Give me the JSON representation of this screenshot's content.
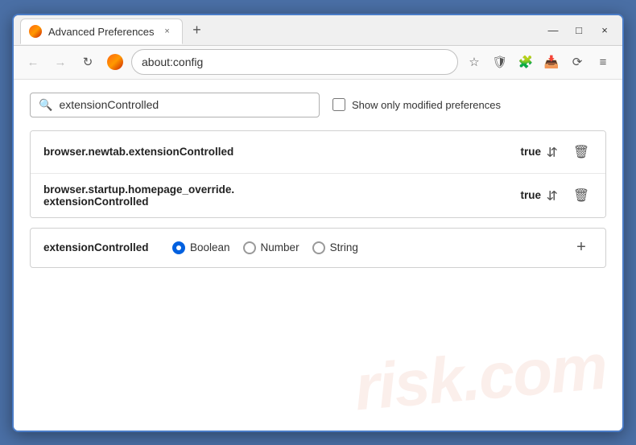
{
  "window": {
    "title": "Advanced Preferences",
    "tab_close": "×",
    "tab_new": "+",
    "min": "—",
    "max": "□",
    "close": "×"
  },
  "nav": {
    "back": "←",
    "forward": "→",
    "reload": "↻",
    "firefox_label": "Firefox",
    "address": "about:config",
    "bookmark": "☆",
    "shield": "🛡",
    "extension": "🧩",
    "pocket": "📥",
    "sync": "⟳",
    "menu": "≡"
  },
  "search": {
    "placeholder": "extensionControlled",
    "value": "extensionControlled",
    "checkbox_label": "Show only modified preferences"
  },
  "results": [
    {
      "name": "browser.newtab.extensionControlled",
      "value": "true"
    },
    {
      "name_line1": "browser.startup.homepage_override.",
      "name_line2": "extensionControlled",
      "value": "true"
    }
  ],
  "add_row": {
    "name": "extensionControlled",
    "type_options": [
      {
        "label": "Boolean",
        "selected": true
      },
      {
        "label": "Number",
        "selected": false
      },
      {
        "label": "String",
        "selected": false
      }
    ],
    "add_label": "+"
  },
  "watermark": "risk.com"
}
